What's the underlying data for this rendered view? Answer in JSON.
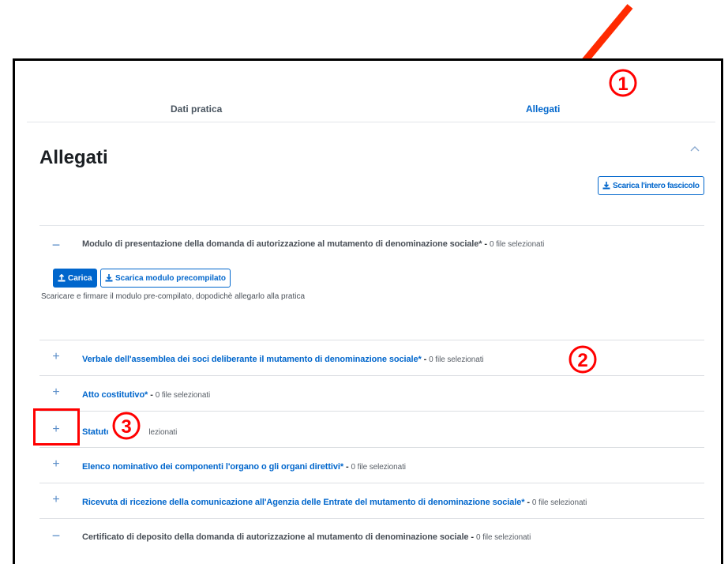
{
  "tabs": [
    {
      "label": "Dati pratica",
      "active": false
    },
    {
      "label": "Allegati",
      "active": true
    }
  ],
  "section": {
    "title": "Allegati",
    "download_all_label": "Scarica l'intero fascicolo"
  },
  "items": [
    {
      "name": "Modulo di presentazione della domanda di autorizzazione al mutamento di denominazione sociale*",
      "separator": " - ",
      "count": "0 file selezionati",
      "expanded": true
    },
    {
      "name": "Verbale dell'assemblea dei soci deliberante il mutamento di denominazione sociale*",
      "separator": " - ",
      "count": "0 file selezionati",
      "expanded": false
    },
    {
      "name": "Atto costitutivo*",
      "separator": " - ",
      "count": "0 file selezionati",
      "expanded": false
    },
    {
      "name": "Statuto*",
      "separator": " - ",
      "count": "0 file selezionati",
      "expanded": false
    },
    {
      "name": "Elenco nominativo dei componenti l'organo o gli organi direttivi*",
      "separator": " - ",
      "count": "0 file selezionati",
      "expanded": false
    },
    {
      "name": "Ricevuta di ricezione della comunicazione all'Agenzia delle Entrate del mutamento di denominazione sociale*",
      "separator": " - ",
      "count": "0 file selezionati",
      "expanded": false
    },
    {
      "name": "Certificato di deposito della domanda di autorizzazione al mutamento di denominazione sociale",
      "separator": " - ",
      "count": "0 file selezionati",
      "expanded": false,
      "disabled": true
    }
  ],
  "expanded_item": {
    "upload_label": "Carica",
    "download_template_label": "Scarica modulo precompilato",
    "hint": "Scaricare e firmare il modulo pre-compilato, dopodichè allegarlo alla pratica"
  },
  "annotations": {
    "callout_1": "1",
    "callout_2": "2",
    "callout_3": "3",
    "color": "#ff0000"
  },
  "colors": {
    "accent": "#0066cc",
    "annotation": "#ff0000"
  }
}
